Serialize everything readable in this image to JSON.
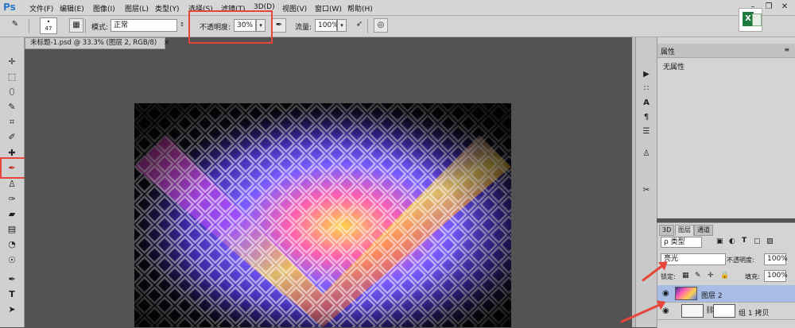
{
  "app": {
    "logo": "Ps"
  },
  "menu": [
    "文件(F)",
    "编辑(E)",
    "图像(I)",
    "图层(L)",
    "类型(Y)",
    "选择(S)",
    "滤镜(T)",
    "3D(D)",
    "视图(V)",
    "窗口(W)",
    "帮助(H)"
  ],
  "options": {
    "brush_size": "47",
    "mode_label": "模式:",
    "mode_value": "正常",
    "opacity_label": "不透明度:",
    "opacity_value": "30%",
    "flow_label": "流量:",
    "flow_value": "100%"
  },
  "document": {
    "tab_title": "未标题-1.psd @ 33.3% (图层 2, RGB/8)"
  },
  "properties": {
    "tab_label": "属性",
    "content": "无属性"
  },
  "layers": {
    "tabs": [
      "3D",
      "图层",
      "通道"
    ],
    "filter_label": "ρ 类型",
    "blend_mode": "亮光",
    "opacity_label": "不透明度:",
    "opacity_value": "100%",
    "lock_label": "锁定:",
    "fill_label": "填充:",
    "fill_value": "100%",
    "items": [
      {
        "name": "图层 2"
      },
      {
        "name": "组 1 拷贝"
      }
    ]
  },
  "colors": {
    "highlight": "#e8463a",
    "selected_layer": "#a8bde6"
  }
}
